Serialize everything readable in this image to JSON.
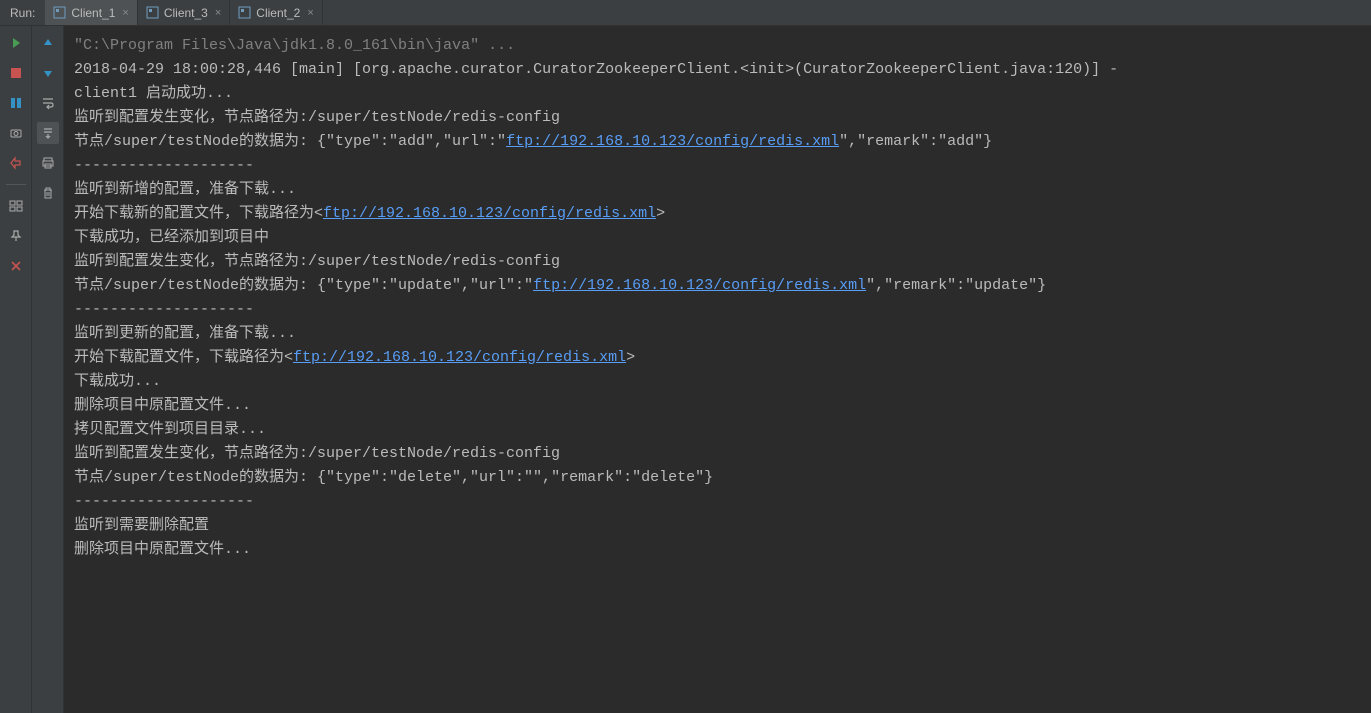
{
  "header": {
    "run_label": "Run:"
  },
  "tabs": [
    {
      "label": "Client_1",
      "active": true
    },
    {
      "label": "Client_3",
      "active": false
    },
    {
      "label": "Client_2",
      "active": false
    }
  ],
  "toolbar_left": {
    "rerun": "rerun-icon",
    "stop": "stop-icon",
    "pause": "pause-icon",
    "screenshot": "camera-icon",
    "exit": "exit-icon",
    "layout": "layout-icon",
    "pin": "pin-icon",
    "close": "close-icon"
  },
  "toolbar_second": {
    "up": "arrow-up-icon",
    "down": "arrow-down-icon",
    "wrap": "wrap-icon",
    "scroll": "scroll-end-icon",
    "print": "print-icon",
    "clear": "trash-icon"
  },
  "console": {
    "lines": [
      {
        "segments": [
          {
            "text": "\"C:\\Program Files\\Java\\jdk1.8.0_161\\bin\\java\" ...",
            "cls": "cmd"
          }
        ]
      },
      {
        "segments": [
          {
            "text": "2018-04-29 18:00:28,446 [main] [org.apache.curator.CuratorZookeeperClient.<init>(CuratorZookeeperClient.java:120)] - "
          }
        ]
      },
      {
        "segments": [
          {
            "text": "client1 启动成功..."
          }
        ]
      },
      {
        "segments": [
          {
            "text": "监听到配置发生变化，节点路径为:/super/testNode/redis-config"
          }
        ]
      },
      {
        "segments": [
          {
            "text": "节点/super/testNode的数据为: {\"type\":\"add\",\"url\":\""
          },
          {
            "text": "ftp://192.168.10.123/config/redis.xml",
            "cls": "link"
          },
          {
            "text": "\",\"remark\":\"add\"}"
          }
        ]
      },
      {
        "segments": [
          {
            "text": ""
          }
        ]
      },
      {
        "segments": [
          {
            "text": "--------------------"
          }
        ]
      },
      {
        "segments": [
          {
            "text": ""
          }
        ]
      },
      {
        "segments": [
          {
            "text": "监听到新增的配置，准备下载..."
          }
        ]
      },
      {
        "segments": [
          {
            "text": "开始下载新的配置文件，下载路径为<"
          },
          {
            "text": "ftp://192.168.10.123/config/redis.xml",
            "cls": "link"
          },
          {
            "text": ">"
          }
        ]
      },
      {
        "segments": [
          {
            "text": "下载成功，已经添加到项目中"
          }
        ]
      },
      {
        "segments": [
          {
            "text": "监听到配置发生变化，节点路径为:/super/testNode/redis-config"
          }
        ]
      },
      {
        "segments": [
          {
            "text": "节点/super/testNode的数据为: {\"type\":\"update\",\"url\":\""
          },
          {
            "text": "ftp://192.168.10.123/config/redis.xml",
            "cls": "link"
          },
          {
            "text": "\",\"remark\":\"update\"}"
          }
        ]
      },
      {
        "segments": [
          {
            "text": ""
          }
        ]
      },
      {
        "segments": [
          {
            "text": "--------------------"
          }
        ]
      },
      {
        "segments": [
          {
            "text": ""
          }
        ]
      },
      {
        "segments": [
          {
            "text": "监听到更新的配置，准备下载..."
          }
        ]
      },
      {
        "segments": [
          {
            "text": "开始下载配置文件，下载路径为<"
          },
          {
            "text": "ftp://192.168.10.123/config/redis.xml",
            "cls": "link"
          },
          {
            "text": ">"
          }
        ]
      },
      {
        "segments": [
          {
            "text": "下载成功..."
          }
        ]
      },
      {
        "segments": [
          {
            "text": "删除项目中原配置文件..."
          }
        ]
      },
      {
        "segments": [
          {
            "text": "拷贝配置文件到项目目录..."
          }
        ]
      },
      {
        "segments": [
          {
            "text": "监听到配置发生变化，节点路径为:/super/testNode/redis-config"
          }
        ]
      },
      {
        "segments": [
          {
            "text": "节点/super/testNode的数据为: {\"type\":\"delete\",\"url\":\"\",\"remark\":\"delete\"}"
          }
        ]
      },
      {
        "segments": [
          {
            "text": ""
          }
        ]
      },
      {
        "segments": [
          {
            "text": "--------------------"
          }
        ]
      },
      {
        "segments": [
          {
            "text": ""
          }
        ]
      },
      {
        "segments": [
          {
            "text": "监听到需要删除配置"
          }
        ]
      },
      {
        "segments": [
          {
            "text": "删除项目中原配置文件..."
          }
        ]
      }
    ]
  }
}
